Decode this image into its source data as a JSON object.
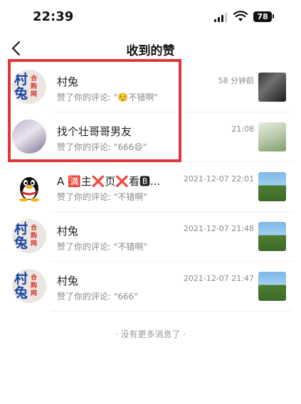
{
  "status_bar": {
    "time": "22:39",
    "battery": "78"
  },
  "nav": {
    "title": "收到的赞"
  },
  "likes": [
    {
      "name": "村兔",
      "comment": "赞了你的评论: \"☺️不错啊\"",
      "time": "58 分钟前",
      "avatar": "logo"
    },
    {
      "name": "找个壮哥哥男友",
      "comment": "赞了你的评论: \"666😄\"",
      "time": "21:08",
      "avatar": "girl"
    },
    {
      "name": "A 🈵主❌页❌看🅱...",
      "comment": "赞了你的评论: \"不错啊\"",
      "time": "2021-12-07 22:01",
      "avatar": "qq-penguin"
    },
    {
      "name": "村兔",
      "comment": "赞了你的评论: \"不错啊\"",
      "time": "2021-12-07 21:48",
      "avatar": "logo"
    },
    {
      "name": "村兔",
      "comment": "赞了你的评论: \"666\"",
      "time": "2021-12-07 21:47",
      "avatar": "logo"
    }
  ],
  "logo_text": {
    "big": "村\n兔",
    "small": "合\n购\n网"
  },
  "end_note": "· 没有更多消息了 ·",
  "colors": {
    "highlight": "#e2373a",
    "logo_blue": "#1b46a8",
    "logo_red": "#d6312b"
  }
}
